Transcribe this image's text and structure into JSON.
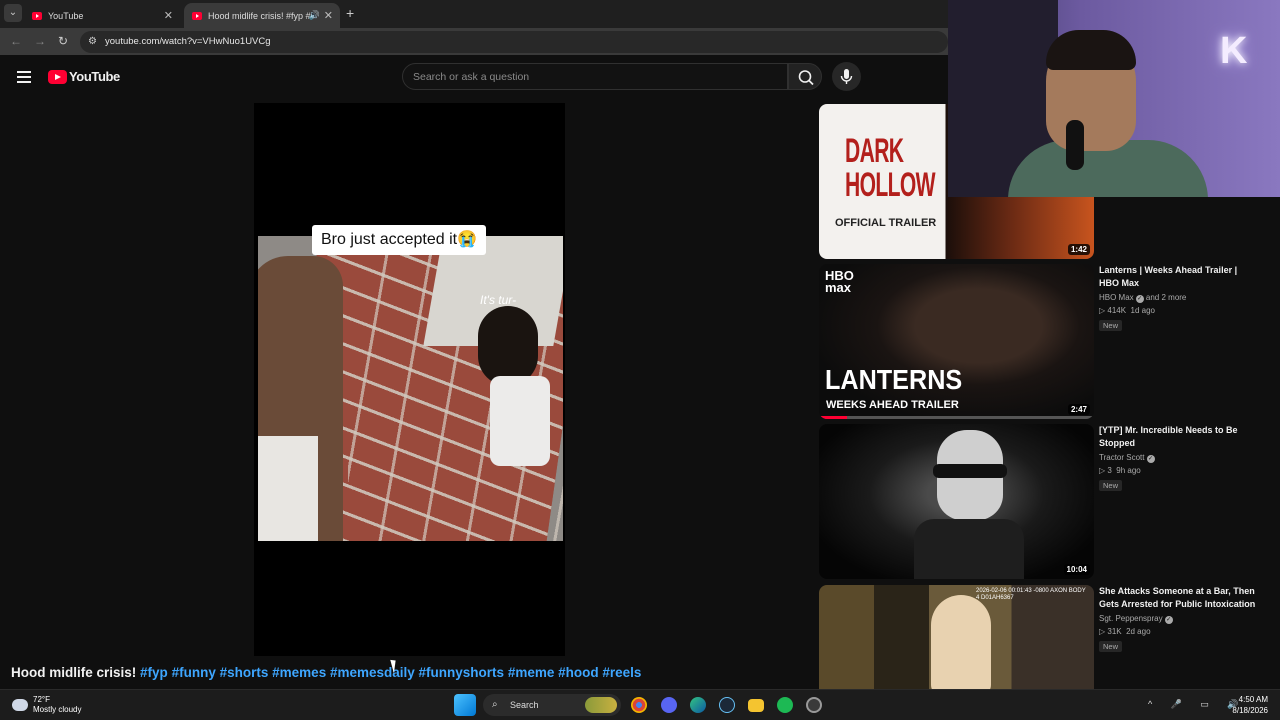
{
  "browser": {
    "tabs": [
      {
        "title": "YouTube"
      },
      {
        "title": "Hood midlife crisis! #fyp #"
      }
    ],
    "url": "youtube.com/watch?v=VHwNuo1UVCg"
  },
  "youtube": {
    "logo_text": "YouTube",
    "search_placeholder": "Search or ask a question"
  },
  "video": {
    "caption": "Bro just accepted it😭",
    "overlay_text": "It's tur-",
    "title": "Hood midlife crisis!",
    "hashtags": [
      "#fyp",
      "#funny",
      "#shorts",
      "#memes",
      "#memesdaily",
      "#funnyshorts",
      "#meme",
      "#hood",
      "#reels"
    ]
  },
  "recommendations": [
    {
      "title": "",
      "thumb_text_1": "DARK",
      "thumb_text_2": "HOLLOW",
      "thumb_text_3": "OFFICIAL TRAILER",
      "duration": "1:42"
    },
    {
      "title": "Lanterns | Weeks Ahead Trailer | HBO Max",
      "channel": "HBO Max",
      "channel_extra": "and 2 more",
      "views": "414K",
      "age": "1d ago",
      "badge": "New",
      "duration": "2:47",
      "thumb_brand_1": "HBO",
      "thumb_brand_2": "max",
      "thumb_text_1": "LANTERNS",
      "thumb_text_2": "WEEKS AHEAD TRAILER",
      "progress": 0.1
    },
    {
      "title": "[YTP] Mr. Incredible Needs to Be Stopped",
      "channel": "Tractor Scott",
      "views": "3",
      "age": "9h ago",
      "badge": "New",
      "duration": "10:04"
    },
    {
      "title": "She Attacks Someone at a Bar, Then Gets Arrested for Public Intoxication",
      "channel": "Sgt. Peppenspray",
      "views": "31K",
      "age": "2d ago",
      "badge": "New",
      "thumb_stamp": "2026-02-06 00:01:43 -0800 AXON BODY 4 D01AH6367"
    }
  ],
  "webcam": {
    "sign_letter": "K"
  },
  "taskbar": {
    "temperature": "72°F",
    "weather": "Mostly cloudy",
    "search_label": "Search",
    "time": "4:50 AM",
    "date": "8/18/2026"
  },
  "colors": {
    "yt_red": "#ff0033",
    "hashtag_blue": "#3ea6ff",
    "page_bg": "#0f0f0f"
  }
}
